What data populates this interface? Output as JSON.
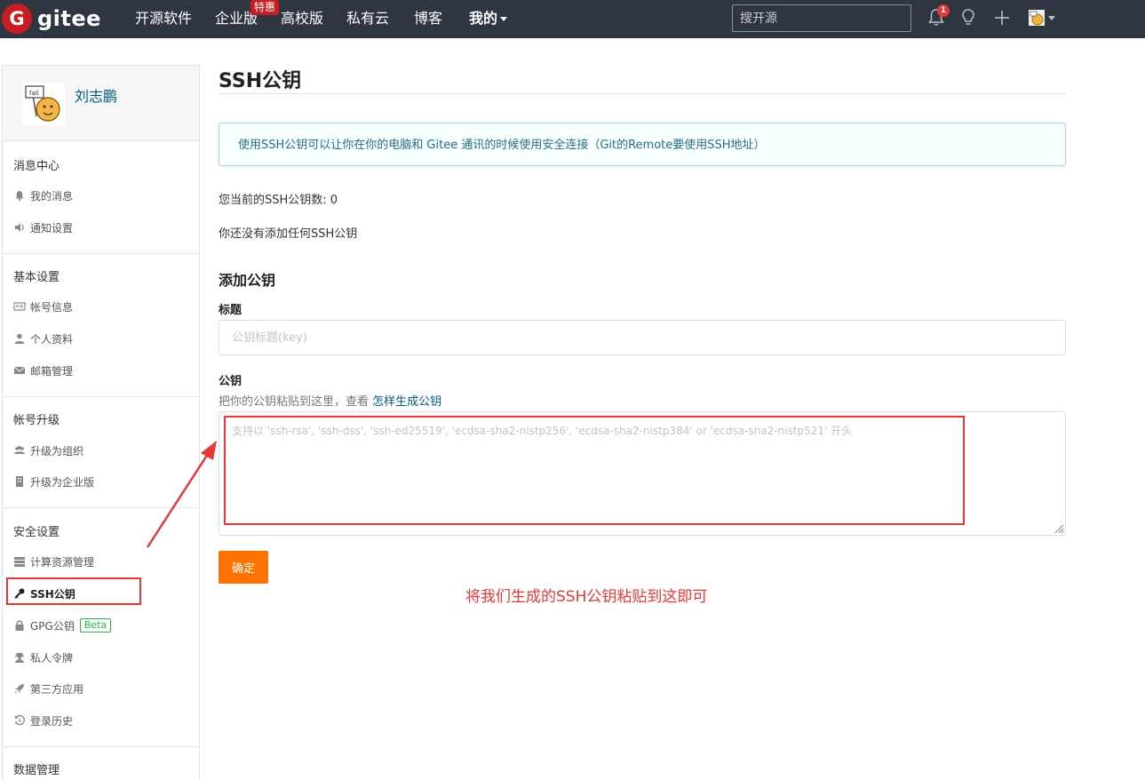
{
  "nav": {
    "logo_letter": "G",
    "logo_text": "gitee",
    "items": [
      "开源软件",
      "企业版",
      "高校版",
      "私有云",
      "博客",
      "我的"
    ],
    "badge": "特惠",
    "search_placeholder": "搜开源",
    "notification_count": "1"
  },
  "sidebar": {
    "user_name": "刘志鹏",
    "groups": [
      {
        "title": "消息中心",
        "items": [
          "我的消息",
          "通知设置"
        ]
      },
      {
        "title": "基本设置",
        "items": [
          "帐号信息",
          "个人资料",
          "邮箱管理"
        ]
      },
      {
        "title": "帐号升级",
        "items": [
          "升级为组织",
          "升级为企业版"
        ]
      },
      {
        "title": "安全设置",
        "items": [
          "计算资源管理",
          "SSH公钥",
          "GPG公钥",
          "私人令牌",
          "第三方应用",
          "登录历史"
        ]
      },
      {
        "title": "数据管理",
        "items": []
      }
    ],
    "beta_label": "Beta",
    "active_item": "SSH公钥"
  },
  "main": {
    "title": "SSH公钥",
    "info": "使用SSH公钥可以让你在你的电脑和 Gitee 通讯的时候使用安全连接（Git的Remote要使用SSH地址）",
    "key_count_text": "您当前的SSH公钥数: 0",
    "no_key_text": "你还没有添加任何SSH公钥",
    "add_title": "添加公钥",
    "title_label": "标题",
    "title_placeholder": "公钥标题(key)",
    "key_label": "公钥",
    "key_hint": "把你的公钥粘贴到这里，查看",
    "key_hint_link": "怎样生成公钥",
    "key_placeholder": "支持以 'ssh-rsa', 'ssh-dss', 'ssh-ed25519', 'ecdsa-sha2-nistp256', 'ecdsa-sha2-nistp384' or 'ecdsa-sha2-nistp521' 开头",
    "submit_label": "确定"
  },
  "annotation": {
    "text": "将我们生成的SSH公钥粘贴到这即可",
    "color": "#e53935"
  },
  "colors": {
    "navbar": "#2f3541",
    "brand": "#c71d23",
    "button": "#fe7300",
    "link": "#005980"
  }
}
